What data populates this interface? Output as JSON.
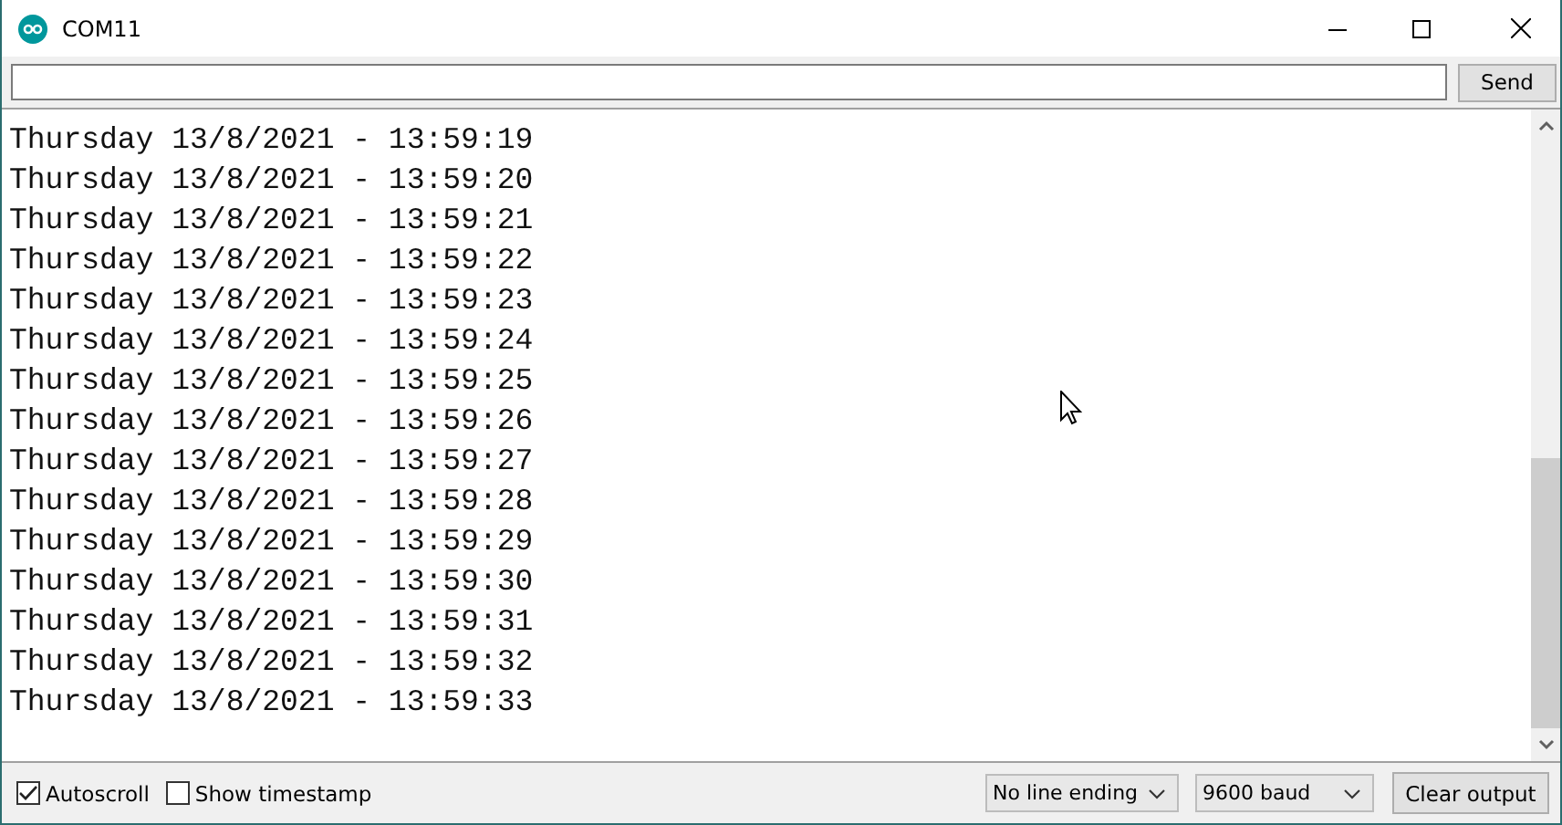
{
  "window": {
    "title": "COM11"
  },
  "send_button": "Send",
  "output_lines": [
    "Thursday 13/8/2021 - 13:59:19",
    "Thursday 13/8/2021 - 13:59:20",
    "Thursday 13/8/2021 - 13:59:21",
    "Thursday 13/8/2021 - 13:59:22",
    "Thursday 13/8/2021 - 13:59:23",
    "Thursday 13/8/2021 - 13:59:24",
    "Thursday 13/8/2021 - 13:59:25",
    "Thursday 13/8/2021 - 13:59:26",
    "Thursday 13/8/2021 - 13:59:27",
    "Thursday 13/8/2021 - 13:59:28",
    "Thursday 13/8/2021 - 13:59:29",
    "Thursday 13/8/2021 - 13:59:30",
    "Thursday 13/8/2021 - 13:59:31",
    "Thursday 13/8/2021 - 13:59:32",
    "Thursday 13/8/2021 - 13:59:33"
  ],
  "footer": {
    "checkboxes": [
      {
        "label": "Autoscroll",
        "checked": true
      },
      {
        "label": "Show timestamp",
        "checked": false
      }
    ],
    "dropdowns": [
      {
        "value": "No line ending"
      },
      {
        "value": "9600 baud"
      }
    ],
    "clear_button": "Clear output"
  }
}
